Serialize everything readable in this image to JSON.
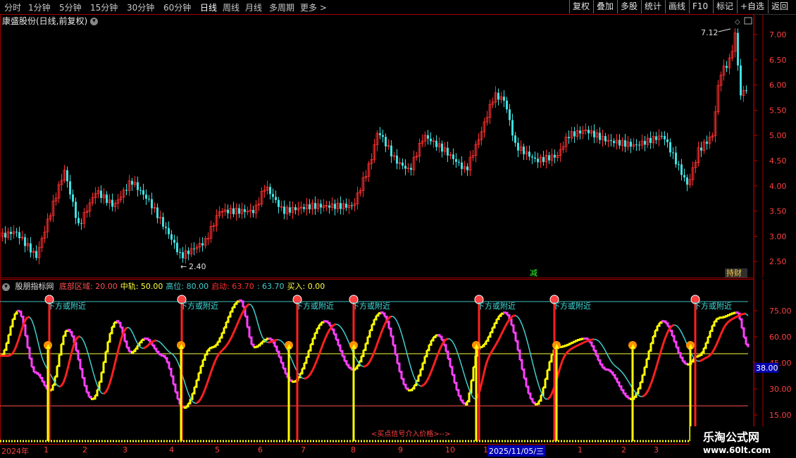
{
  "toolbar": {
    "timeframes": [
      "分时",
      "1分钟",
      "5分钟",
      "15分钟",
      "30分钟",
      "60分钟",
      "日线",
      "周线",
      "月线",
      "多周期",
      "更多 >"
    ],
    "active_timeframe": "日线",
    "right_buttons": [
      "复权",
      "叠加",
      "多股",
      "统计",
      "画线",
      "F10",
      "标记",
      "+自选",
      "返回"
    ]
  },
  "stock": {
    "title": "康盛股份(日线,前复权)",
    "high_label": "7.12",
    "low_label": "2.40",
    "markers": [
      "减",
      "持财"
    ],
    "price_axis": [
      "7.00",
      "6.50",
      "6.00",
      "5.50",
      "5.00",
      "4.50",
      "4.00",
      "3.50",
      "3.00",
      "2.50"
    ]
  },
  "indicator": {
    "name": "股朋指标网",
    "params": [
      {
        "label": "底部区域:",
        "value": "20.00",
        "color": "#ff5050"
      },
      {
        "label": "中轨:",
        "value": "50.00",
        "color": "#ffff40"
      },
      {
        "label": "高位:",
        "value": "80.00",
        "color": "#40d0d0"
      },
      {
        "label": "启动:",
        "value": "63.70",
        "color": "#ff3030"
      },
      {
        "label": ":",
        "value": "63.70",
        "color": "#40d0d0"
      },
      {
        "label": "买入:",
        "value": "0.00",
        "color": "#ffff40"
      }
    ],
    "axis": [
      "75.00",
      "60.00",
      "45.00",
      "30.00",
      "15.00"
    ],
    "axis_highlight": "38.00",
    "annotation": "下方或附近",
    "buy_text": "<买点信号介入价格>-->"
  },
  "dates": {
    "year": "2024年",
    "months": [
      "1",
      "2",
      "3",
      "4",
      "5",
      "6",
      "7",
      "8",
      "9",
      "10",
      "11",
      "1",
      "2",
      "3"
    ],
    "cursor_date": "2025/11/05/三"
  },
  "watermark": {
    "brand": "乐淘公式网",
    "url": "www.60lt.com"
  },
  "colors": {
    "up": "#ff3030",
    "down": "#40e0e0",
    "yellow": "#ffff00",
    "magenta": "#ff40ff",
    "cyan": "#40d0d0"
  }
}
